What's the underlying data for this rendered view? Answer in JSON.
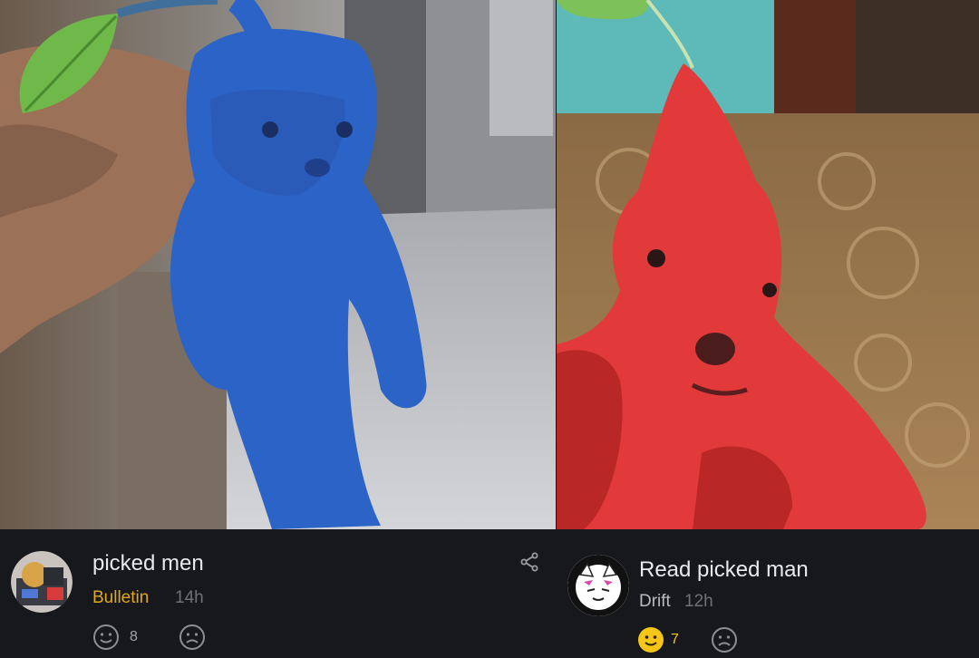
{
  "colors": {
    "background": "#17181c",
    "title_text": "#e9e9ec",
    "meta_text": "#6f7178",
    "bulletin_accent": "#e2a81c",
    "drift_text": "#b9bbc2",
    "reaction_active": "#f5c518"
  },
  "posts": [
    {
      "image_alt_icon": "blue-kitten-photo",
      "title": "picked men",
      "community": "Bulletin",
      "time": "14h",
      "likes": "8",
      "share_icon": "share-icon"
    },
    {
      "image_alt_icon": "red-puppy-photo",
      "title": "Read picked man",
      "community": "Drift",
      "time": "12h",
      "likes": "7"
    }
  ]
}
